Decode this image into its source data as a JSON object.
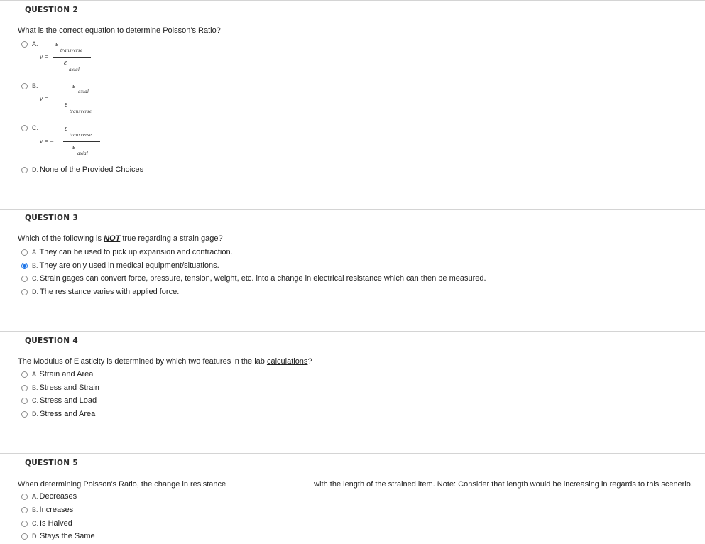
{
  "q2": {
    "header": "QUESTION 2",
    "prompt": "What is the correct equation to determine Poisson's Ratio?",
    "options": [
      {
        "letter": "A.",
        "lhs": "ν =",
        "num_sym": "ε",
        "num_sub": "transverse",
        "den_sym": "ε",
        "den_sub": "axial",
        "selected": false
      },
      {
        "letter": "B.",
        "lhs": "ν = –",
        "num_sym": "ε",
        "num_sub": "axial",
        "den_sym": "ε",
        "den_sub": "transverse",
        "selected": false
      },
      {
        "letter": "C.",
        "lhs": "ν = –",
        "num_sym": "ε",
        "num_sub": "transverse",
        "den_sym": "ε",
        "den_sub": "axial",
        "selected": false
      },
      {
        "letter": "D.",
        "text": "None of the Provided Choices",
        "selected": false
      }
    ]
  },
  "q3": {
    "header": "QUESTION 3",
    "prompt_pre": "Which of the following is ",
    "prompt_em": "NOT",
    "prompt_post": " true regarding a strain gage?",
    "options": [
      {
        "letter": "A.",
        "text": "They can be used to pick up expansion and contraction.",
        "selected": false
      },
      {
        "letter": "B.",
        "text": "They are only used in medical equipment/situations.",
        "selected": true
      },
      {
        "letter": "C.",
        "text": "Strain gages can convert force, pressure, tension, weight, etc. into a change in electrical resistance which can then be measured.",
        "selected": false
      },
      {
        "letter": "D.",
        "text": "The resistance varies with applied force.",
        "selected": false
      }
    ]
  },
  "q4": {
    "header": "QUESTION 4",
    "prompt_pre": "The Modulus of Elasticity is determined by which two features in the lab ",
    "prompt_link": "calculations",
    "prompt_post": "?",
    "options": [
      {
        "letter": "A.",
        "text": "Strain and Area",
        "selected": false
      },
      {
        "letter": "B.",
        "text": "Stress and Strain",
        "selected": false
      },
      {
        "letter": "C.",
        "text": "Stress and Load",
        "selected": false
      },
      {
        "letter": "D.",
        "text": "Stress and Area",
        "selected": false
      }
    ]
  },
  "q5": {
    "header": "QUESTION 5",
    "prompt_pre": "When determining Poisson's Ratio, the change in resistance",
    "prompt_post": "with the length of the strained item. Note: Consider that length would be increasing in regards to this scenerio.",
    "options": [
      {
        "letter": "A.",
        "text": "Decreases",
        "selected": false
      },
      {
        "letter": "B.",
        "text": "Increases",
        "selected": false
      },
      {
        "letter": "C.",
        "text": "Is Halved",
        "selected": false
      },
      {
        "letter": "D.",
        "text": "Stays the Same",
        "selected": false
      }
    ]
  }
}
